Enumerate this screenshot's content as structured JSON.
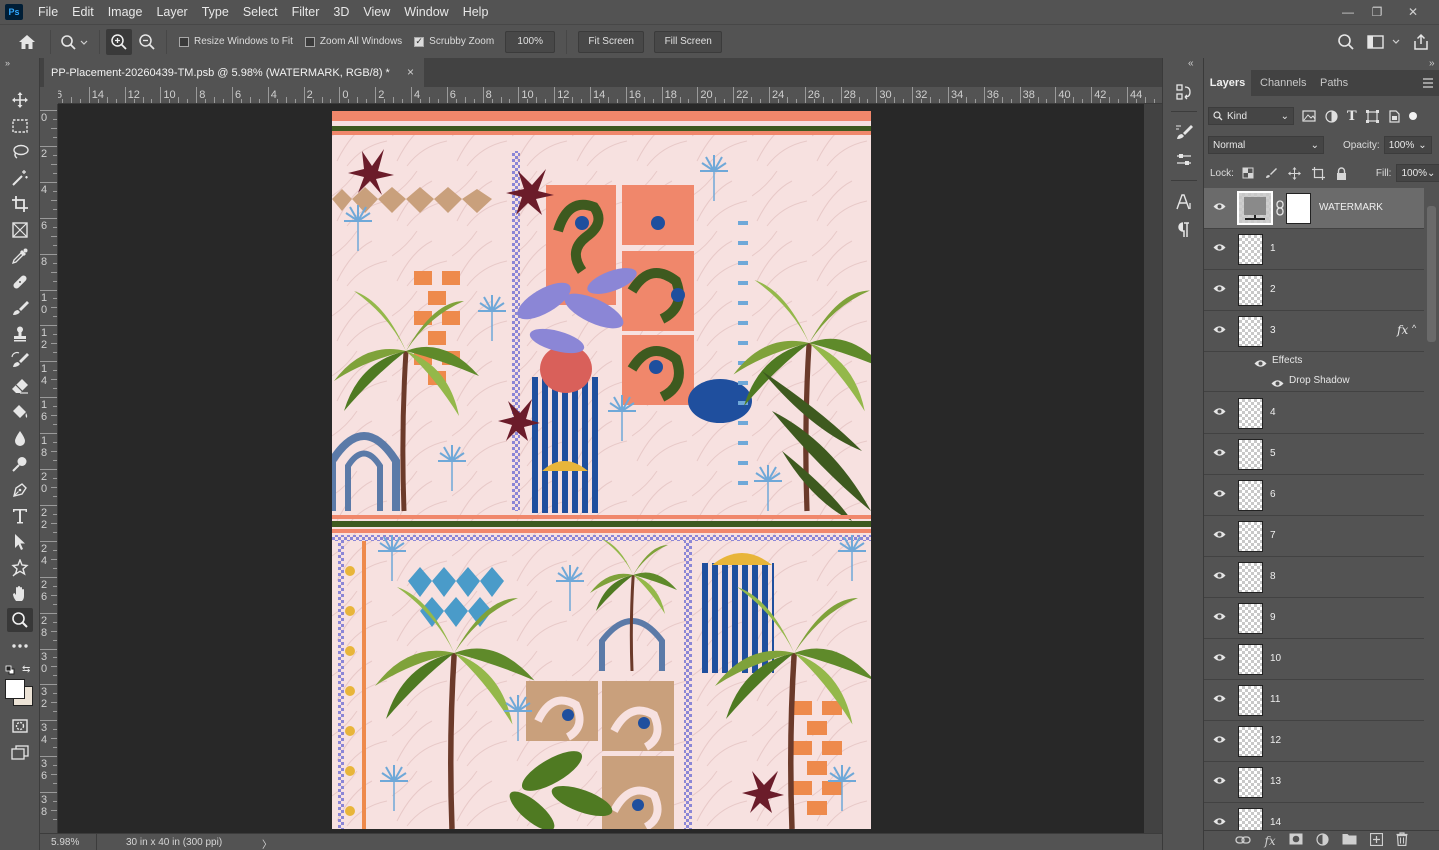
{
  "app": {
    "logo": "Ps",
    "menu": [
      "File",
      "Edit",
      "Image",
      "Layer",
      "Type",
      "Select",
      "Filter",
      "3D",
      "View",
      "Window",
      "Help"
    ]
  },
  "window_controls": {
    "minimize": "—",
    "restore": "❐",
    "close": "✕"
  },
  "options_bar": {
    "resize_windows_to_fit": "Resize Windows to Fit",
    "zoom_all_windows": "Zoom All Windows",
    "scrubby_zoom": "Scrubby Zoom",
    "zoom_value": "100%",
    "fit_screen": "Fit Screen",
    "fill_screen": "Fill Screen",
    "scrubby_zoom_checked": true,
    "resize_checked": false,
    "zoom_all_checked": false
  },
  "document": {
    "tab_title": "PP-Placement-20260439-TM.psb @ 5.98% (WATERMARK, RGB/8) *",
    "close": "×"
  },
  "ruler": {
    "h_labels": [
      "6",
      "14",
      "12",
      "10",
      "8",
      "6",
      "4",
      "2",
      "0",
      "2",
      "4",
      "6",
      "8",
      "10",
      "12",
      "14",
      "16",
      "18",
      "20",
      "22",
      "24",
      "26",
      "28",
      "30",
      "32",
      "34",
      "36",
      "38",
      "40",
      "42",
      "44"
    ],
    "v_labels": [
      "0",
      "2",
      "4",
      "6",
      "8",
      "10",
      "12",
      "14",
      "16",
      "18",
      "20",
      "22",
      "24",
      "26",
      "28",
      "30",
      "32",
      "34",
      "36",
      "38"
    ]
  },
  "status": {
    "zoom": "5.98%",
    "doc_info": "30 in x 40 in (300 ppi)",
    "arrow": "〉"
  },
  "panel": {
    "collapse_left": "«",
    "collapse_right": "»",
    "tabs": [
      "Layers",
      "Channels",
      "Paths"
    ],
    "filter_kind": "Kind",
    "blend_mode": "Normal",
    "opacity_label": "Opacity:",
    "opacity_value": "100%",
    "lock_label": "Lock:",
    "fill_label": "Fill:",
    "fill_value": "100%"
  },
  "layers": [
    {
      "name": "WATERMARK",
      "selected": true
    },
    {
      "name": "1"
    },
    {
      "name": "2"
    },
    {
      "name": "3",
      "fx": "fx",
      "effects_label": "Effects",
      "drop_shadow_label": "Drop Shadow"
    },
    {
      "name": "4"
    },
    {
      "name": "5"
    },
    {
      "name": "6"
    },
    {
      "name": "7"
    },
    {
      "name": "8"
    },
    {
      "name": "9"
    },
    {
      "name": "10"
    },
    {
      "name": "11"
    },
    {
      "name": "12"
    },
    {
      "name": "13"
    },
    {
      "name": "14"
    }
  ],
  "colors": {
    "accent_blue": "#31a8ff",
    "canvas_bg": "#f7e1e0",
    "pasteboard": "#282828",
    "chrome": "#535353",
    "coral": "#f0876b",
    "orange": "#ee8a4c",
    "leaf_green": "#7fa23a",
    "dark_green": "#3e5a1f",
    "cobalt": "#1f4f9e",
    "lavender": "#8b86d6",
    "steel_blue": "#5b7aa8",
    "mustard": "#e8b53a",
    "tan": "#c9a07c",
    "maroon": "#6b1c2a"
  },
  "icons": [
    "home-icon",
    "zoom-icon",
    "zoom-in-icon",
    "zoom-out-icon",
    "search-icon",
    "workspace-icon",
    "share-icon",
    "move-tool-icon",
    "marquee-tool-icon",
    "lasso-tool-icon",
    "magic-wand-icon",
    "crop-tool-icon",
    "frame-tool-icon",
    "eyedropper-icon",
    "healing-brush-icon",
    "brush-tool-icon",
    "clone-stamp-icon",
    "history-brush-icon",
    "eraser-icon",
    "paint-bucket-icon",
    "blur-tool-icon",
    "dodge-tool-icon",
    "pen-tool-icon",
    "type-tool-icon",
    "path-selection-icon",
    "shape-tool-icon",
    "hand-tool-icon",
    "zoom-tool-icon",
    "eye-icon",
    "link-icon",
    "fx-icon",
    "mask-icon",
    "adjustment-icon",
    "folder-icon",
    "new-layer-icon",
    "trash-icon"
  ]
}
